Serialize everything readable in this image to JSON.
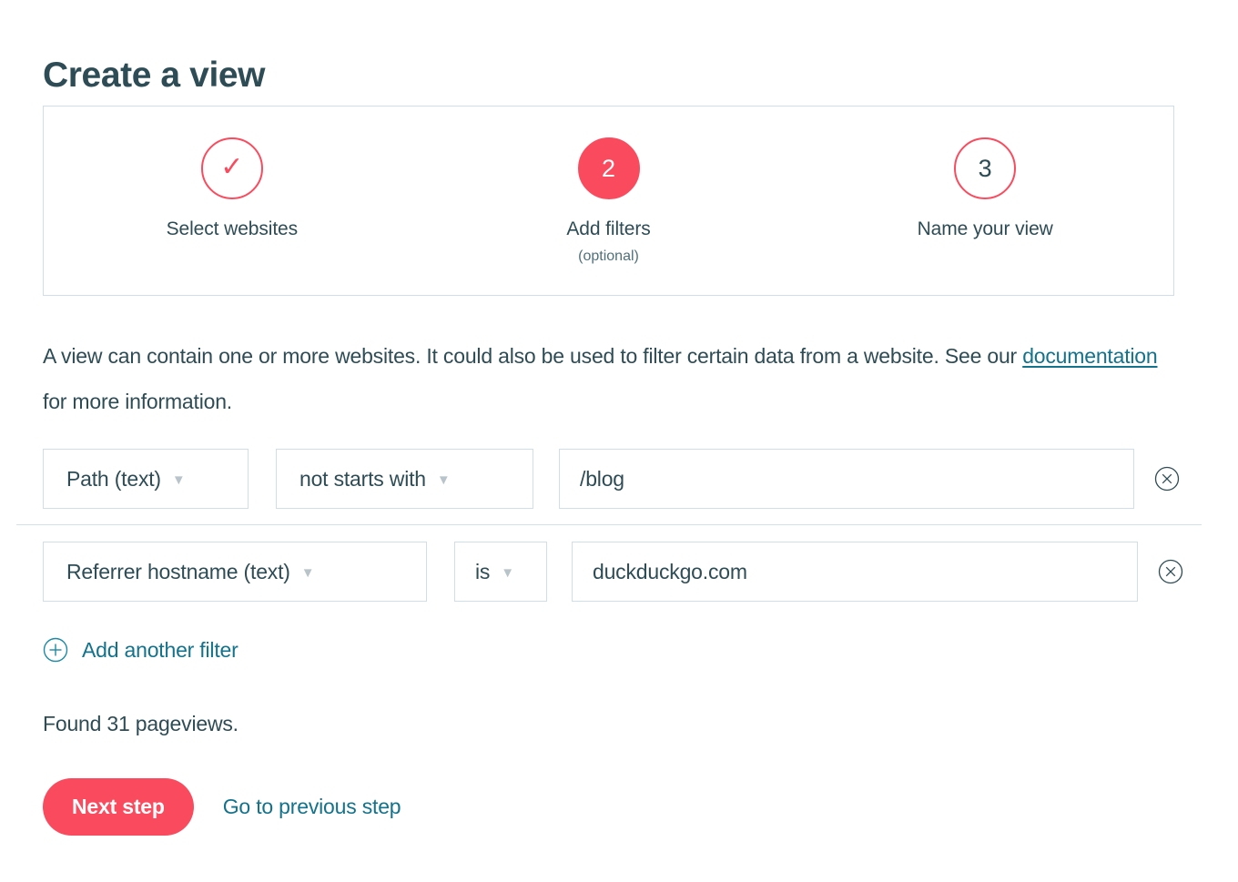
{
  "page": {
    "title": "Create a view"
  },
  "stepper": {
    "steps": [
      {
        "indicator": "✓",
        "state": "completed",
        "label": "Select websites",
        "sub": ""
      },
      {
        "indicator": "2",
        "state": "active",
        "label": "Add filters",
        "sub": "(optional)"
      },
      {
        "indicator": "3",
        "state": "upcoming",
        "label": "Name your view",
        "sub": ""
      }
    ]
  },
  "description": {
    "before_link": "A view can contain one or more websites. It could also be used to filter certain data from a website. See our ",
    "link_text": "documentation",
    "after_link": " for more information."
  },
  "filters": [
    {
      "field": "Path (text)",
      "operator": "not starts with",
      "value": "/blog",
      "value_placeholder": "",
      "remove_icon": "circle-x-icon"
    },
    {
      "field": "Referrer hostname (text)",
      "operator": "is",
      "value": "duckduckgo.com",
      "value_placeholder": "",
      "remove_icon": "circle-x-icon"
    }
  ],
  "add_filter": {
    "icon": "circle-plus-icon",
    "label": "Add another filter"
  },
  "result": {
    "text": "Found 31 pageviews."
  },
  "actions": {
    "primary_label": "Next step",
    "secondary_label": "Go to previous step"
  },
  "colors": {
    "accent_pink": "#fa4b5e",
    "link_teal": "#13728c",
    "text_dark": "#2e4c55",
    "border_light": "#cfdeea"
  }
}
